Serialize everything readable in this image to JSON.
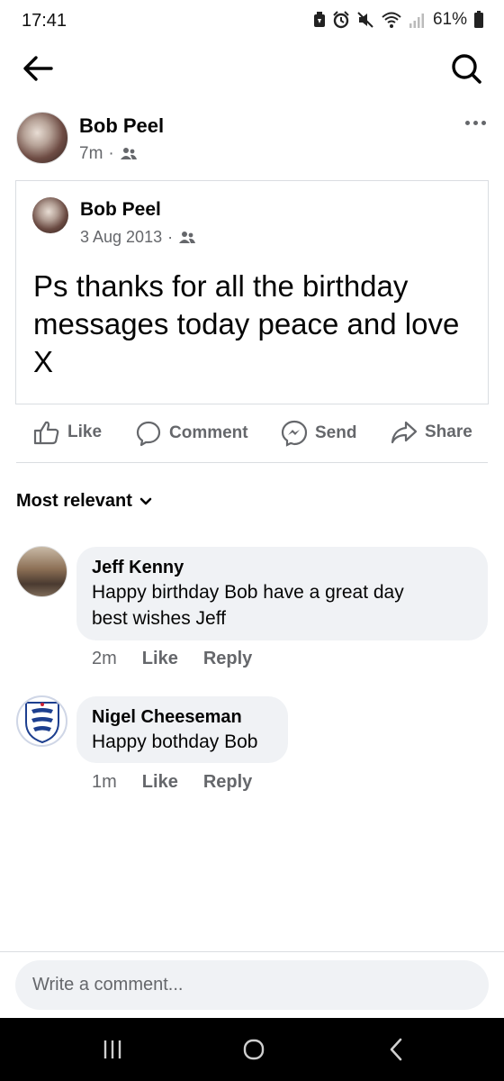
{
  "status": {
    "time": "17:41",
    "battery": "61%",
    "icons": [
      "data-saver-icon",
      "alarm-icon",
      "mute-icon",
      "wifi-icon",
      "signal-icon",
      "battery-icon"
    ]
  },
  "nav": {
    "back_icon": "arrow-left-icon",
    "search_icon": "search-icon"
  },
  "post": {
    "author": "Bob Peel",
    "time": "7m",
    "audience_icon": "friends-icon",
    "shared": {
      "author": "Bob Peel",
      "date": "3 Aug 2013",
      "audience_icon": "friends-icon",
      "text": "Ps thanks for all the birthday messages today peace and love X"
    }
  },
  "actions": {
    "like": "Like",
    "comment": "Comment",
    "send": "Send",
    "share": "Share"
  },
  "comments_section": {
    "sort_label": "Most relevant",
    "comments": [
      {
        "author": "Jeff Kenny",
        "text_line1": "Happy birthday Bob have a great day",
        "text_line2": "best wishes Jeff",
        "time": "2m",
        "like": "Like",
        "reply": "Reply"
      },
      {
        "author": "Nigel Cheeseman",
        "text_line1": "Happy bothday Bob",
        "time": "1m",
        "like": "Like",
        "reply": "Reply"
      }
    ]
  },
  "composer": {
    "placeholder": "Write a comment..."
  },
  "colors": {
    "text": "#050505",
    "secondary": "#65676b",
    "bubble": "#f0f2f5",
    "divider": "#dadde1"
  }
}
